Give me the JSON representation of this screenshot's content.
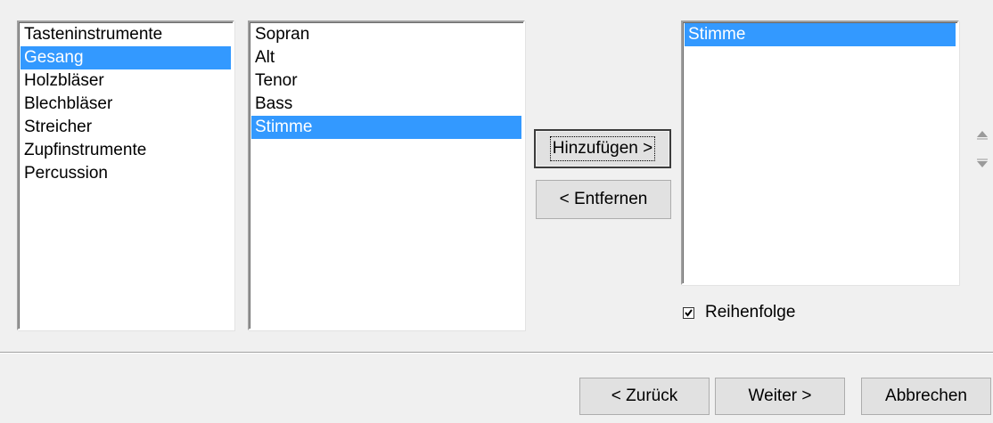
{
  "categories": {
    "items": [
      "Tasteninstrumente",
      "Gesang",
      "Holzbläser",
      "Blechbläser",
      "Streicher",
      "Zupfinstrumente",
      "Percussion"
    ],
    "selected_index": 1
  },
  "instruments": {
    "items": [
      "Sopran",
      "Alt",
      "Tenor",
      "Bass",
      "Stimme"
    ],
    "selected_index": 4
  },
  "buttons": {
    "add_label": "Hinzufügen >",
    "remove_label": "< Entfernen",
    "back_label": "< Zurück",
    "next_label": "Weiter >",
    "cancel_label": "Abbrechen"
  },
  "selected_list": {
    "items": [
      "Stimme"
    ],
    "selected_index": 0
  },
  "order_option": {
    "label": "Reihenfolge",
    "checked": true
  },
  "icons": {
    "move_up": "triangle-up-icon",
    "move_down": "triangle-down-icon",
    "checkmark": "checkmark-icon"
  },
  "colors": {
    "selection": "#3399ff",
    "window_bg": "#f0f0f0"
  }
}
